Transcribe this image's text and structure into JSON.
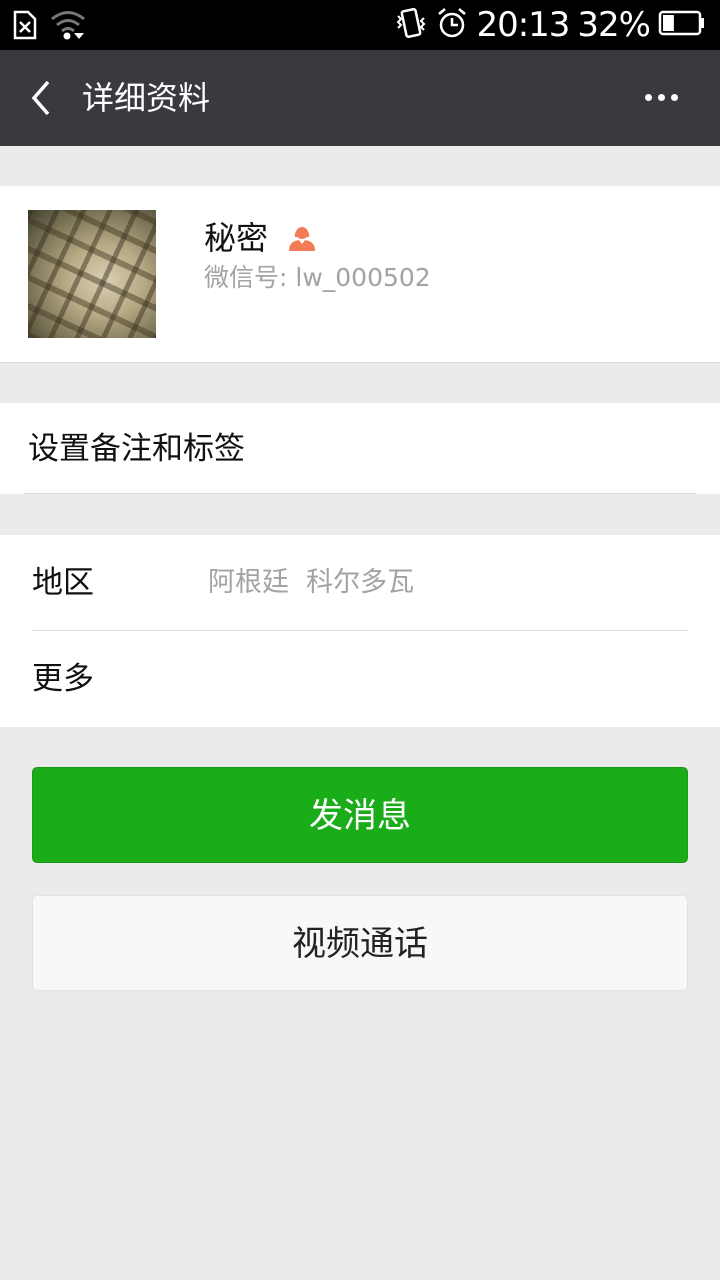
{
  "status_bar": {
    "time": "20:13",
    "battery_percent": "32%",
    "battery_level": 0.32,
    "icons": [
      "sim-missing-icon",
      "wifi-icon",
      "vibrate-icon",
      "alarm-icon",
      "battery-icon"
    ]
  },
  "nav": {
    "title": "详细资料",
    "back_icon": "chevron-left-icon",
    "more_icon": "more-dots-icon"
  },
  "profile": {
    "name": "秘密",
    "wechat_id": "微信号: lw_000502",
    "gender_icon": "female-user-icon",
    "gender_color": "#f37b56"
  },
  "remarks": {
    "label": "设置备注和标签"
  },
  "info": {
    "region_label": "地区",
    "region_value": "阿根廷  科尔多瓦",
    "more_label": "更多"
  },
  "actions": {
    "send_message": "发消息",
    "video_call": "视频通话"
  },
  "colors": {
    "primary": "#1aad19",
    "navbar": "#393a3f",
    "background": "#ebebeb"
  }
}
